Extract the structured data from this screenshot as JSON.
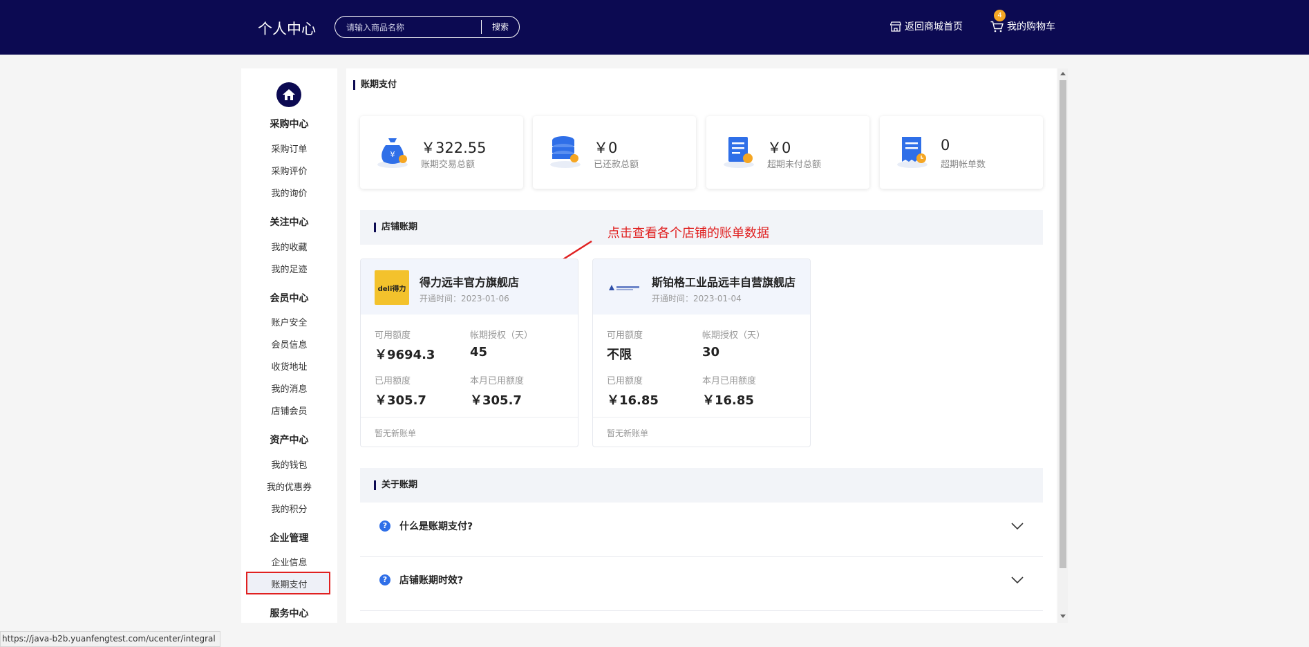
{
  "header": {
    "title": "个人中心",
    "search_placeholder": "请输入商品名称",
    "search_button": "搜索",
    "home_link": "返回商城首页",
    "cart_link": "我的购物车",
    "cart_count": "4"
  },
  "sidebar": {
    "groups": [
      {
        "title": "采购中心",
        "items": [
          "采购订单",
          "采购评价",
          "我的询价"
        ]
      },
      {
        "title": "关注中心",
        "items": [
          "我的收藏",
          "我的足迹"
        ]
      },
      {
        "title": "会员中心",
        "items": [
          "账户安全",
          "会员信息",
          "收货地址",
          "我的消息",
          "店铺会员"
        ]
      },
      {
        "title": "资产中心",
        "items": [
          "我的钱包",
          "我的优惠券",
          "我的积分"
        ]
      },
      {
        "title": "企业管理",
        "items": [
          "企业信息",
          "账期支付"
        ]
      },
      {
        "title": "服务中心",
        "items": []
      }
    ],
    "active_item": "账期支付"
  },
  "page_title": "账期支付",
  "stats": [
    {
      "value": "￥322.55",
      "label": "账期交易总额",
      "icon": "money-bag-icon"
    },
    {
      "value": "￥0",
      "label": "已还款总额",
      "icon": "coin-stack-icon"
    },
    {
      "value": "￥0",
      "label": "超期未付总额",
      "icon": "document-coin-icon"
    },
    {
      "value": "0",
      "label": "超期帐单数",
      "icon": "receipt-clock-icon"
    }
  ],
  "store_section_title": "店铺账期",
  "annotation": "点击查看各个店铺的账单数据",
  "stores": [
    {
      "name": "得力远丰官方旗舰店",
      "open_date": "开通时间：2023-01-06",
      "logo_text": "deli得力",
      "available_label": "可用额度",
      "available": "￥9694.3",
      "days_label": "帐期授权（天）",
      "days": "45",
      "used_label": "已用额度",
      "used": "￥305.7",
      "month_label": "本月已用额度",
      "month_used": "￥305.7",
      "bill_status": "暂无新账单"
    },
    {
      "name": "斯铂格工业品远丰自营旗舰店",
      "open_date": "开通时间：2023-01-04",
      "logo_text": "",
      "available_label": "可用额度",
      "available": "不限",
      "days_label": "帐期授权（天）",
      "days": "30",
      "used_label": "已用额度",
      "used": "￥16.85",
      "month_label": "本月已用额度",
      "month_used": "￥16.85",
      "bill_status": "暂无新账单"
    }
  ],
  "about_title": "关于账期",
  "faq": [
    {
      "question": "什么是账期支付?"
    },
    {
      "question": "店铺账期时效?"
    }
  ],
  "status_url": "https://java-b2b.yuanfengtest.com/ucenter/integral",
  "colors": {
    "header_bg": "#0c0a52",
    "accent_blue": "#2f6fe8",
    "annotation_red": "#e02020",
    "badge_orange": "#f5a623",
    "logo_yellow": "#f3c22c"
  }
}
